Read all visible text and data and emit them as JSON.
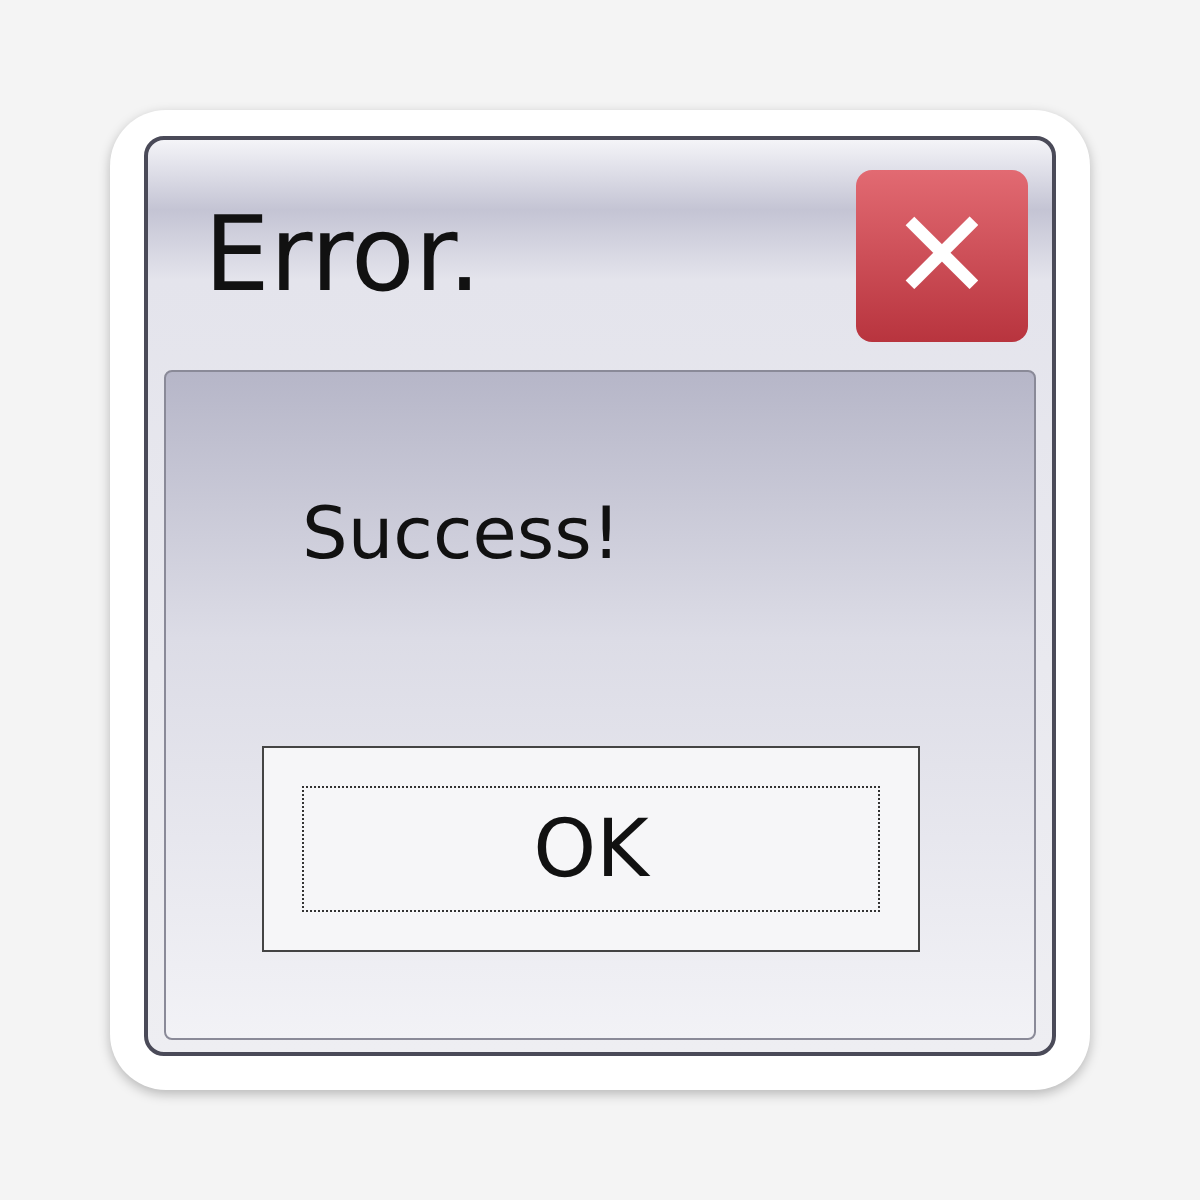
{
  "window": {
    "title": "Error.",
    "close_button": "✕"
  },
  "message": "Success!",
  "buttons": [
    {
      "label": "OK",
      "focused": true
    }
  ]
}
